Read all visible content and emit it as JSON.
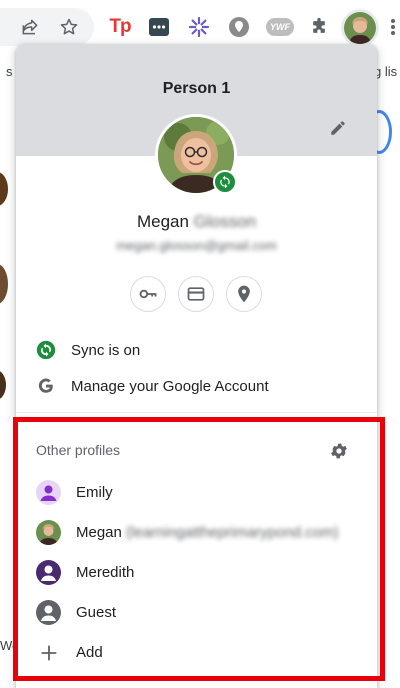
{
  "toolbar": {
    "icons": [
      "share-icon",
      "bookmark-star-icon",
      "tp-extension-icon",
      "password-manager-extension-icon",
      "sparkle-extension-icon",
      "location-extension-icon",
      "ywf-extension-icon",
      "extensions-puzzle-icon",
      "profile-avatar",
      "more-menu-icon"
    ],
    "tp_label": "Tp",
    "ywf_label": "YWF"
  },
  "bookmarks": {
    "left_fragment": "s",
    "right_fragment": "g lis"
  },
  "background": {
    "left_fragment": "Wo"
  },
  "profile_menu": {
    "title": "Person 1",
    "name_first": "Megan",
    "name_last": "Glosson",
    "email": "megan.glosson@gmail.com",
    "quick_actions": [
      "passwords-key-icon",
      "payment-card-icon",
      "addresses-pin-icon"
    ],
    "items": [
      {
        "icon": "sync-icon",
        "label": "Sync is on"
      },
      {
        "icon": "google-g-icon",
        "label": "Manage your Google Account"
      }
    ],
    "other_profiles": {
      "header": "Other profiles",
      "profiles": [
        {
          "name": "Emily",
          "secondary": "",
          "avatar_color": "#8430ce"
        },
        {
          "name": "Megan",
          "secondary": "(learningattheprimarypond.com)",
          "avatar_color": "#6b8f4e"
        },
        {
          "name": "Meredith",
          "secondary": "",
          "avatar_color": "#4a2a6e"
        },
        {
          "name": "Guest",
          "secondary": "",
          "avatar_color": "#5f6368"
        }
      ],
      "add_label": "Add"
    }
  },
  "colors": {
    "highlight": "#e8000b",
    "sync_green": "#1e8e3e",
    "header_gray": "#dadce0"
  }
}
